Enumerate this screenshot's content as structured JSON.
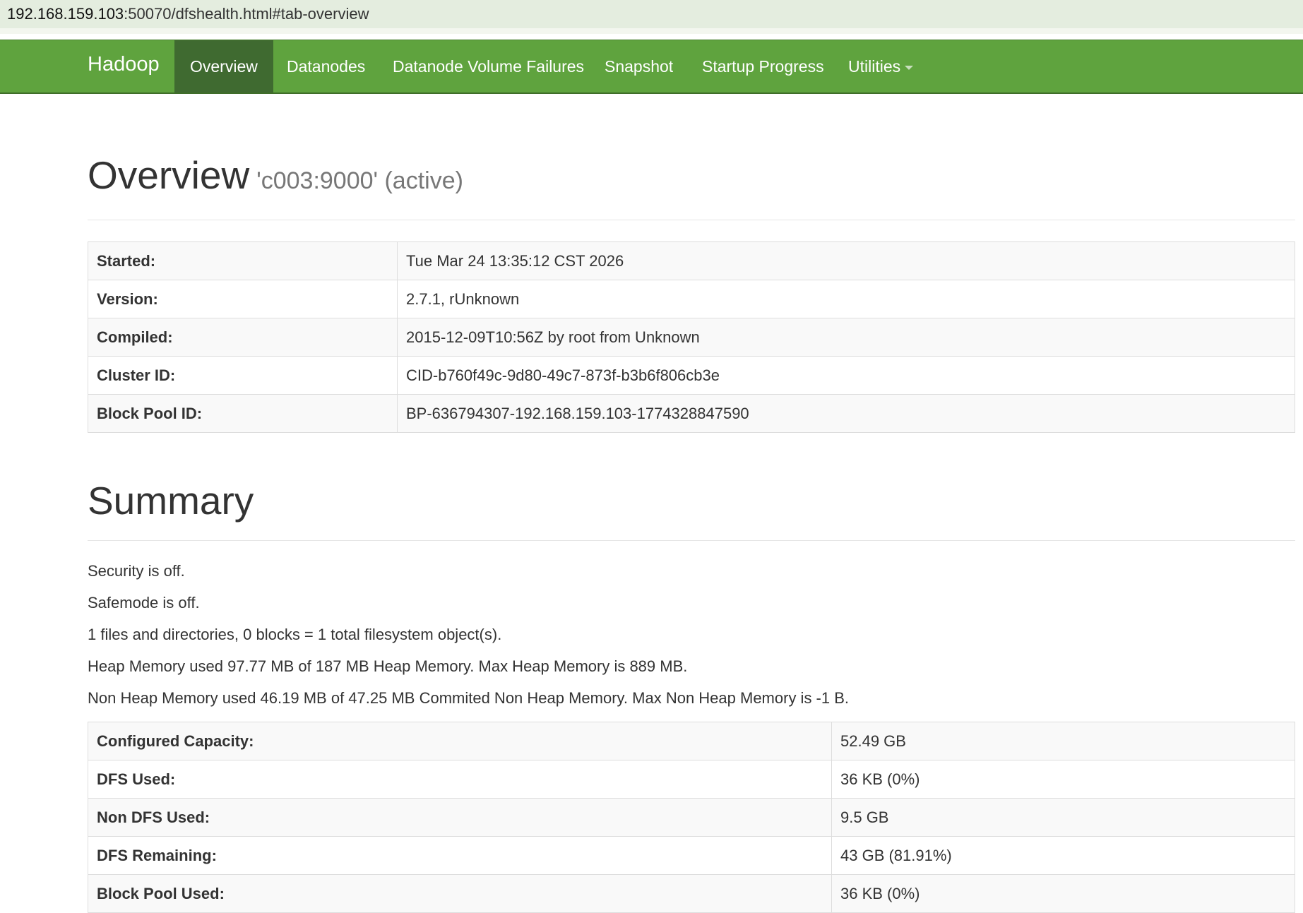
{
  "browser": {
    "url_host": "192.168.159.103",
    "url_rest": ":50070/dfshealth.html#tab-overview"
  },
  "navbar": {
    "brand": "Hadoop",
    "items": [
      {
        "label": "Overview",
        "active": true
      },
      {
        "label": "Datanodes",
        "active": false
      },
      {
        "label": "Datanode Volume Failures",
        "active": false
      },
      {
        "label": "Snapshot",
        "active": false
      },
      {
        "label": "Startup Progress",
        "active": false
      },
      {
        "label": "Utilities",
        "active": false,
        "dropdown": true
      }
    ]
  },
  "overview": {
    "title": "Overview",
    "subtitle": "'c003:9000' (active)",
    "rows": [
      {
        "label": "Started:",
        "value": "Tue Mar 24 13:35:12 CST 2026"
      },
      {
        "label": "Version:",
        "value": "2.7.1, rUnknown"
      },
      {
        "label": "Compiled:",
        "value": "2015-12-09T10:56Z by root from Unknown"
      },
      {
        "label": "Cluster ID:",
        "value": "CID-b760f49c-9d80-49c7-873f-b3b6f806cb3e"
      },
      {
        "label": "Block Pool ID:",
        "value": "BP-636794307-192.168.159.103-1774328847590"
      }
    ]
  },
  "summary": {
    "title": "Summary",
    "lines": [
      "Security is off.",
      "Safemode is off.",
      "1 files and directories, 0 blocks = 1 total filesystem object(s).",
      "Heap Memory used 97.77 MB of 187 MB Heap Memory. Max Heap Memory is 889 MB.",
      "Non Heap Memory used 46.19 MB of 47.25 MB Commited Non Heap Memory. Max Non Heap Memory is -1 B."
    ],
    "rows": [
      {
        "label": "Configured Capacity:",
        "value": "52.49 GB"
      },
      {
        "label": "DFS Used:",
        "value": "36 KB (0%)"
      },
      {
        "label": "Non DFS Used:",
        "value": "9.5 GB"
      },
      {
        "label": "DFS Remaining:",
        "value": "43 GB (81.91%)"
      },
      {
        "label": "Block Pool Used:",
        "value": "36 KB (0%)"
      }
    ]
  },
  "colors": {
    "navbar_bg": "#5fa33e",
    "navbar_active": "#3f6a30",
    "url_bar_bg": "#e4eddf"
  }
}
